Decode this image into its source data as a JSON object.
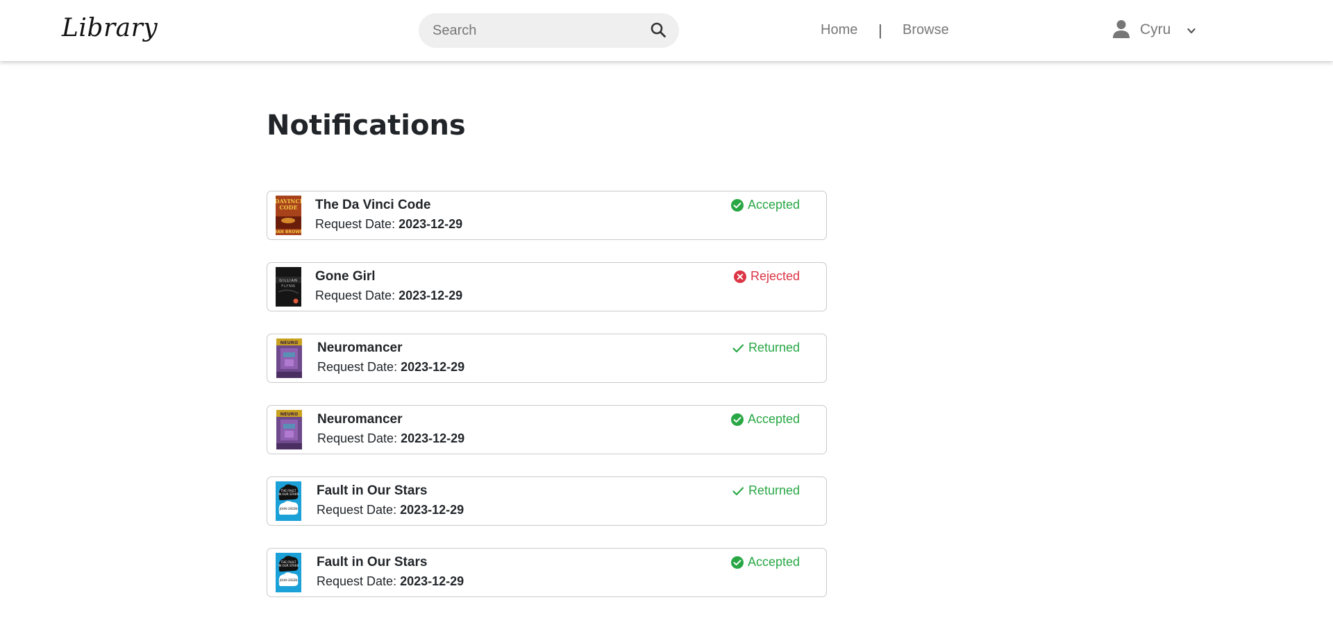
{
  "brand": "Library",
  "search": {
    "placeholder": "Search"
  },
  "nav": {
    "home": "Home",
    "separator": "|",
    "browse": "Browse"
  },
  "user": {
    "name": "Cyru"
  },
  "page": {
    "title": "Notifications"
  },
  "labels": {
    "request_date": "Request Date:"
  },
  "colors": {
    "accepted": "#28a745",
    "returned": "#28a745",
    "rejected": "#dc3545",
    "card_border": "#c9c9c9"
  },
  "notifications": [
    {
      "title": "The Da Vinci Code",
      "date": "2023-12-29",
      "status": "Accepted",
      "status_icon": "check-circle-icon",
      "cover": "da-vinci-code-cover"
    },
    {
      "title": "Gone Girl",
      "date": "2023-12-29",
      "status": "Rejected",
      "status_icon": "x-circle-icon",
      "cover": "gone-girl-cover"
    },
    {
      "title": "Neuromancer",
      "date": "2023-12-29",
      "status": "Returned",
      "status_icon": "check-icon",
      "cover": "neuromancer-cover"
    },
    {
      "title": "Neuromancer",
      "date": "2023-12-29",
      "status": "Accepted",
      "status_icon": "check-circle-icon",
      "cover": "neuromancer-cover"
    },
    {
      "title": "Fault in Our Stars",
      "date": "2023-12-29",
      "status": "Returned",
      "status_icon": "check-icon",
      "cover": "fault-in-our-stars-cover"
    },
    {
      "title": "Fault in Our Stars",
      "date": "2023-12-29",
      "status": "Accepted",
      "status_icon": "check-circle-icon",
      "cover": "fault-in-our-stars-cover"
    }
  ]
}
